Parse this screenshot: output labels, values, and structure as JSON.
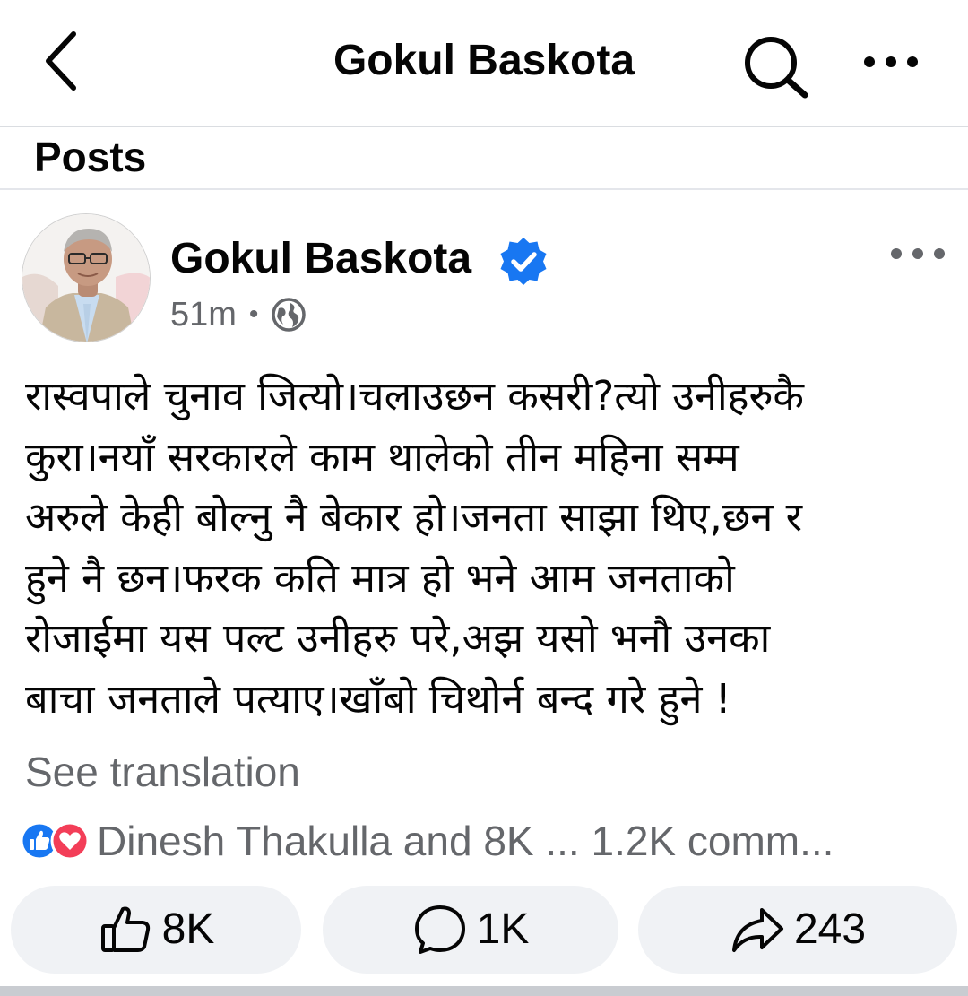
{
  "header": {
    "title": "Gokul Baskota",
    "back_icon": "chevron-left-icon",
    "search_icon": "search-icon",
    "more_icon": "more-horizontal-icon"
  },
  "section": {
    "label": "Posts"
  },
  "post": {
    "author": "Gokul Baskota",
    "verified": true,
    "time": "51m",
    "separator": "•",
    "audience_icon": "globe-icon",
    "text": "रास्वपाले चुनाव जित्यो।चलाउछन कसरी?त्यो उनीहरुकै\nकुरा।नयाँ सरकारले काम थालेको तीन महिना सम्म\nअरुले केही बोल्नु नै बेकार हो।जनता साझा थिए,छन र\nहुने नै छन।फरक कति मात्र हो भने आम  जनताको\nरोजाईमा यस पल्ट उनीहरु परे,अझ यसो भनौ उनका\nबाचा जनताले पत्याए।खाँबो चिथोर्न बन्द गरे हुने !",
    "see_translation": "See translation",
    "reactions_summary": "Dinesh Thakulla and 8K ... 1.2K comm...",
    "reaction_icons": [
      "like-icon",
      "love-icon"
    ]
  },
  "actions": {
    "like_count": "8K",
    "comment_count": "1K",
    "share_count": "243"
  },
  "colors": {
    "facebook_blue": "#1877f2",
    "love_red": "#f33e58",
    "secondary_text": "#65676b",
    "button_bg": "#f0f2f5"
  }
}
